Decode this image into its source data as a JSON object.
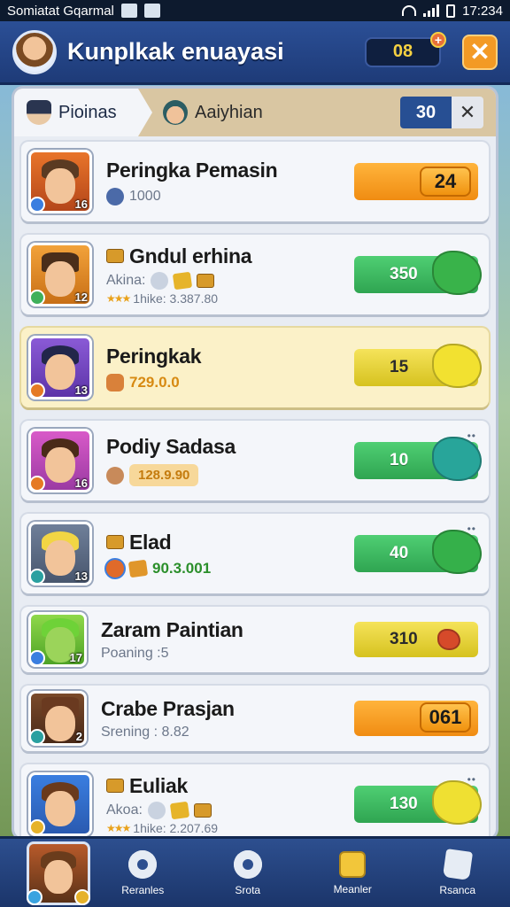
{
  "status_bar": {
    "carrier": "Somiatat Gqarmal",
    "time": "17:234"
  },
  "header": {
    "title": "Kunplkak enuayasi",
    "coins": "08",
    "coin_plus": "+",
    "close": "✕"
  },
  "tabs": [
    {
      "label": "Pioinas",
      "active": true
    },
    {
      "label": "Aaiyhian",
      "active": false
    }
  ],
  "count": "30",
  "count_close": "✕",
  "rows": [
    {
      "name": "Peringka Pemasin",
      "level": "16",
      "sub": "1000",
      "score": "24",
      "score_style": "orange"
    },
    {
      "name": "Gndul erhina",
      "level": "12",
      "sub": "Akina:",
      "sub2": "1hike: 3.387.80",
      "score": "350",
      "score_style": "green"
    },
    {
      "name": "Peringkak",
      "level": "13",
      "sub": "729.0.0",
      "score": "15",
      "score_style": "yellow"
    },
    {
      "name": "Podiy Sadasa",
      "level": "16",
      "sub": "128.9.90",
      "score": "10",
      "score_style": "green"
    },
    {
      "name": "Elad",
      "level": "13",
      "sub": "90.3.001",
      "score": "40",
      "score_style": "green"
    },
    {
      "name": "Zaram Paintian",
      "level": "17",
      "sub": "Poaning :5",
      "score": "310",
      "score_style": "yellow"
    },
    {
      "name": "Crabe Prasjan",
      "level": "2",
      "sub": "Srening : 8.82",
      "score": "061",
      "score_style": "orange"
    },
    {
      "name": "Euliak",
      "level": "",
      "sub": "Akoa:",
      "sub2": "1hike: 2.207.69",
      "score": "130",
      "score_style": "green"
    }
  ],
  "nav": [
    {
      "label": "Reranles"
    },
    {
      "label": "Srota"
    },
    {
      "label": "Meanler"
    },
    {
      "label": "Rsanca"
    }
  ],
  "colors": {
    "header_bg": "#2b4f96",
    "accent_orange": "#f39a25",
    "score_green": "#2fa551",
    "score_yellow": "#d6c21f"
  }
}
